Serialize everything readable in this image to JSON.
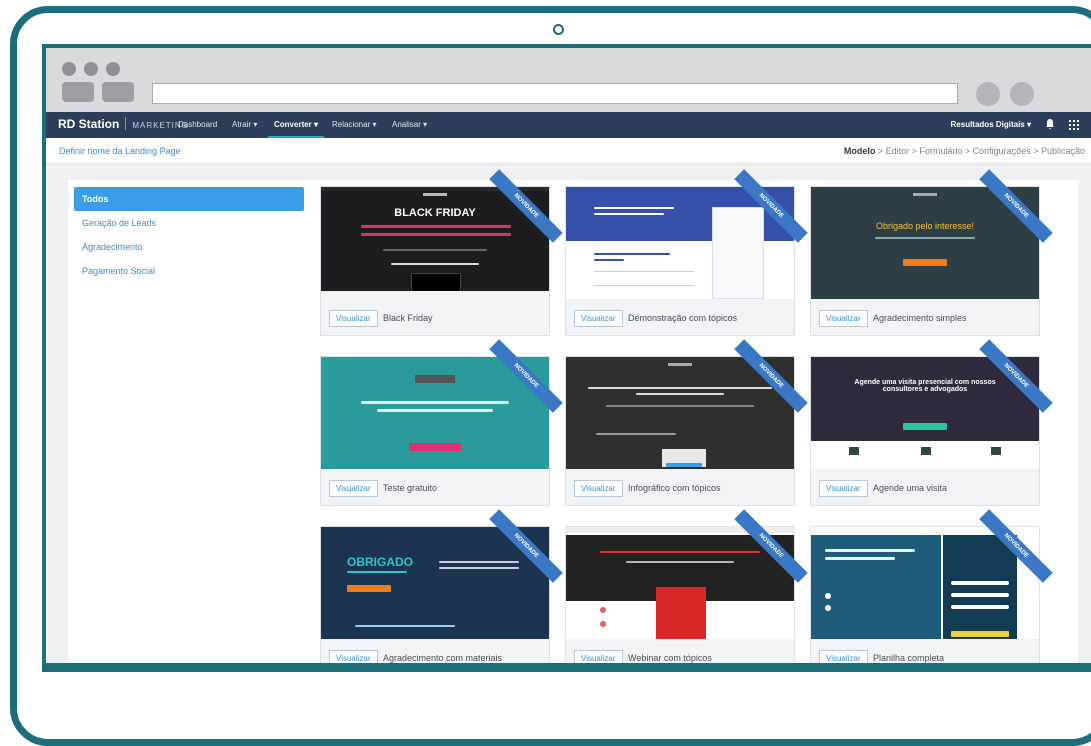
{
  "browser": {
    "url": ""
  },
  "app": {
    "logo_brand": "RD Station",
    "logo_product": "MARKETING",
    "nav": [
      "Dashboard",
      "Atrair ▾",
      "Converter ▾",
      "Relacionar ▾",
      "Analisar ▾"
    ],
    "account": "Resultados Digitais ▾"
  },
  "subbar": {
    "landing_page_name": "Definir nome da Landing Page",
    "steps_active": "Modelo",
    "steps_rest": " > Editor > Formulário > Configurações > Publicação"
  },
  "sidebar": {
    "items": [
      "Todos",
      "Geração de Leads",
      "Agradecimento",
      "Pagamento Social"
    ]
  },
  "cards": [
    {
      "title": "Black Friday",
      "button": "Visualizar",
      "badge": "NOVIDADE",
      "headline": "BLACK FRIDAY"
    },
    {
      "title": "Demonstração com tópicos",
      "button": "Visualizar",
      "badge": "NOVIDADE",
      "headline": ""
    },
    {
      "title": "Agradecimento simples",
      "button": "Visualizar",
      "badge": "NOVIDADE",
      "headline": "Obrigado pelo interesse!"
    },
    {
      "title": "Teste gratuito",
      "button": "Visualizar",
      "badge": "NOVIDADE",
      "headline": ""
    },
    {
      "title": "Infográfico com tópicos",
      "button": "Visualizar",
      "badge": "NOVIDADE",
      "headline": ""
    },
    {
      "title": "Agende uma visita",
      "button": "Visualizar",
      "badge": "NOVIDADE",
      "headline": "Agende uma visita presencial com nossos consultores e advogados"
    },
    {
      "title": "Agradecimento com materiais",
      "button": "Visualizar",
      "badge": "NOVIDADE",
      "headline": "OBRIGADO"
    },
    {
      "title": "Webinar com tópicos",
      "button": "Visualizar",
      "badge": "NOVIDADE",
      "headline": ""
    },
    {
      "title": "Planilha completa",
      "button": "Visualizar",
      "badge": "NOVIDADE",
      "headline": ""
    }
  ],
  "colors": {
    "device": "#1a6f7a",
    "nav_bg": "#2c3e59",
    "accent": "#3a9de6",
    "ribbon": "#3a78c5"
  }
}
